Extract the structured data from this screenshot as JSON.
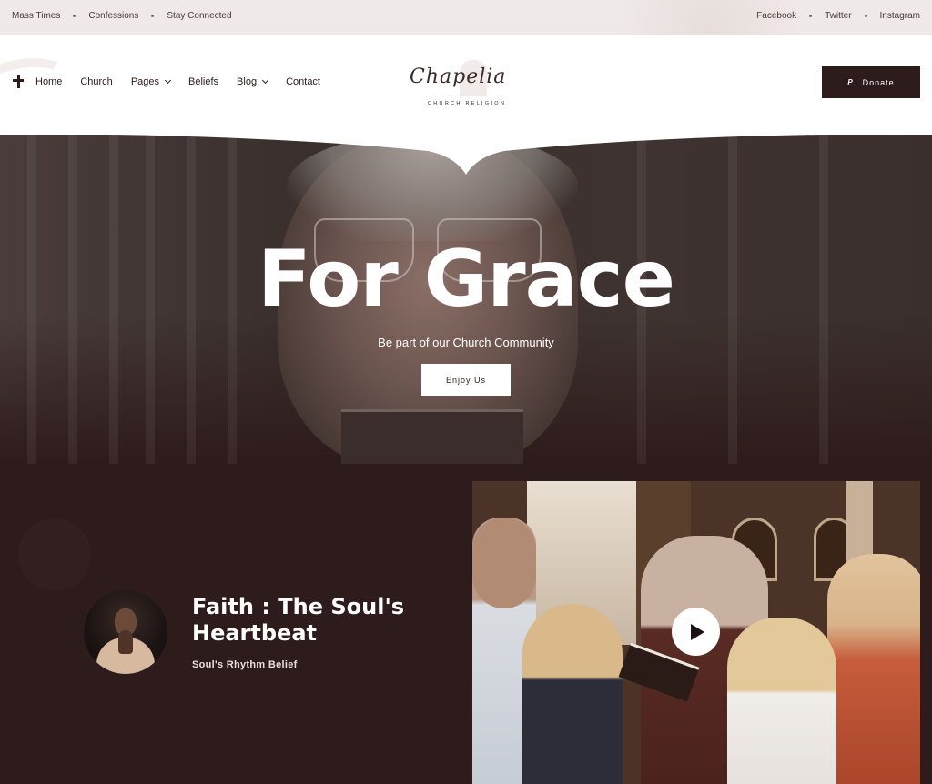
{
  "topbar": {
    "left_links": [
      "Mass Times",
      "Confessions",
      "Stay Connected"
    ],
    "right_links": [
      "Facebook",
      "Twitter",
      "Instagram"
    ]
  },
  "header": {
    "nav": {
      "home": "Home",
      "church": "Church",
      "pages": "Pages",
      "beliefs": "Beliefs",
      "blog": "Blog",
      "contact": "Contact"
    },
    "logo": {
      "script": "Chapelia",
      "subtitle": "CHURCH RELIGION"
    },
    "donate_label": "Donate",
    "donate_icon": "paypal-icon"
  },
  "hero": {
    "title": "For Grace",
    "subtitle": "Be part of our Church Community",
    "button_label": "Enjoy Us"
  },
  "feature": {
    "title": "Faith : The Soul's Heartbeat",
    "subtitle": "Soul's Rhythm Belief",
    "play_icon": "play-icon"
  },
  "colors": {
    "brand_dark": "#2e1b1b",
    "topbar_bg": "#efe9e7",
    "white": "#ffffff"
  }
}
